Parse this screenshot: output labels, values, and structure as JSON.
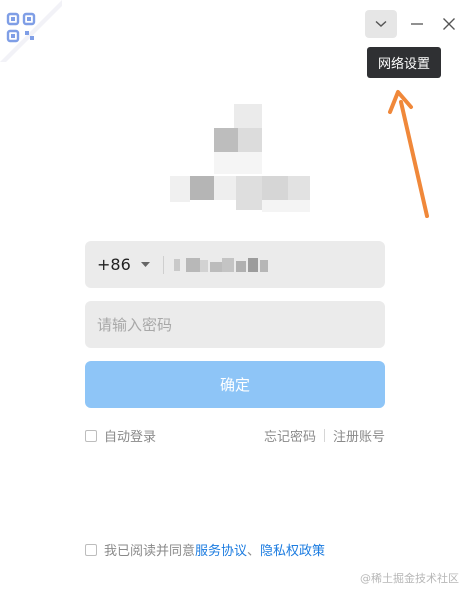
{
  "window": {
    "dropdown_icon": "chevron-down-icon",
    "minimize_icon": "minimize-icon",
    "close_icon": "close-icon",
    "tooltip": "网络设置"
  },
  "qr_corner_icon": "qr-code-icon",
  "login": {
    "country_code": "+86",
    "password_placeholder": "请输入密码",
    "confirm_label": "确定",
    "auto_login_label": "自动登录",
    "forgot_password": "忘记密码",
    "register": "注册账号"
  },
  "agreement": {
    "prefix": "我已阅读并同意",
    "service_agreement": "服务协议",
    "separator": "、",
    "privacy_policy": "隐私权政策"
  },
  "watermark": "@稀土掘金技术社区",
  "colors": {
    "accent": "#1c7ce0",
    "confirm_disabled": "#8ec5f7",
    "annotation_arrow": "#f0883a"
  }
}
